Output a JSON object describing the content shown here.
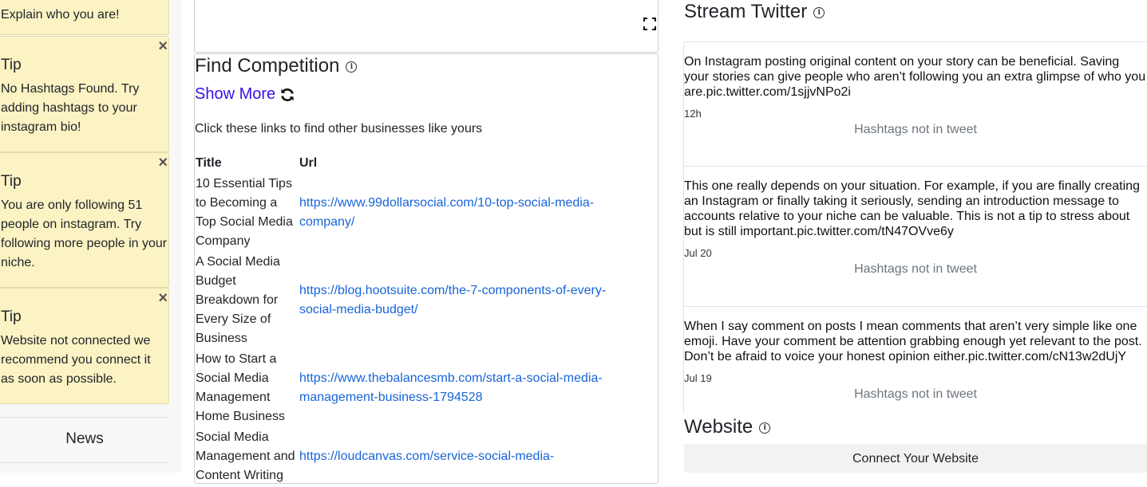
{
  "left": {
    "partial_text": "Explain who you are!",
    "tips": [
      {
        "title": "Tip",
        "body": "No Hashtags Found. Try adding hashtags to your instagram bio!",
        "close": "×"
      },
      {
        "title": "Tip",
        "body": "You are only following 51 people on instagram. Try following more people in your niche.",
        "close": "×"
      },
      {
        "title": "Tip",
        "body": "Website not connected we recommend you connect it as soon as possible.",
        "close": "×"
      }
    ],
    "news_label": "News"
  },
  "competition": {
    "title": "Find Competition",
    "show_more": "Show More",
    "description": "Click these links to find other businesses like yours",
    "columns": [
      "Title",
      "Url"
    ],
    "rows": [
      {
        "title": "10 Essential Tips to Becoming a Top Social Media Company",
        "url": "https://www.99dollarsocial.com/10-top-social-media-company/"
      },
      {
        "title": "A Social Media Budget Breakdown for Every Size of Business",
        "url": "https://blog.hootsuite.com/the-7-components-of-every-social-media-budget/"
      },
      {
        "title": "How to Start a Social Media Management Home Business",
        "url": "https://www.thebalancesmb.com/start-a-social-media-management-business-1794528"
      },
      {
        "title": "Social Media Management and Content Writing",
        "url": "https://loudcanvas.com/service-social-media-"
      }
    ]
  },
  "stream": {
    "title": "Stream Twitter",
    "tweets": [
      {
        "text": "On Instagram posting original content on your story can be beneficial. Saving your stories can give people who aren’t following you an extra glimpse of who you are.pic.twitter.com/1sjjvNPo2i",
        "time": "12h",
        "hashtags": "Hashtags not in tweet"
      },
      {
        "text": "This one really depends on your situation. For example, if you are finally creating an Instagram or finally taking it seriously, sending an introduction message to accounts relative to your niche can be valuable. This is not a tip to stress about but is still important.pic.twitter.com/tN47OVve6y",
        "time": "Jul 20",
        "hashtags": "Hashtags not in tweet"
      },
      {
        "text": "When I say comment on posts I mean comments that aren’t very simple like one emoji. Have your comment be attention grabbing enough yet relevant to the post. Don’t be afraid to voice your honest opinion either.pic.twitter.com/cN13w2dUjY",
        "time": "Jul 19",
        "hashtags": "Hashtags not in tweet"
      }
    ]
  },
  "website": {
    "title": "Website",
    "connect_label": "Connect Your Website"
  },
  "info_glyph": "i",
  "colors": {
    "tip_bg": "#fcf3c4",
    "link": "#1864d8",
    "show_more": "#3a0ee8"
  }
}
